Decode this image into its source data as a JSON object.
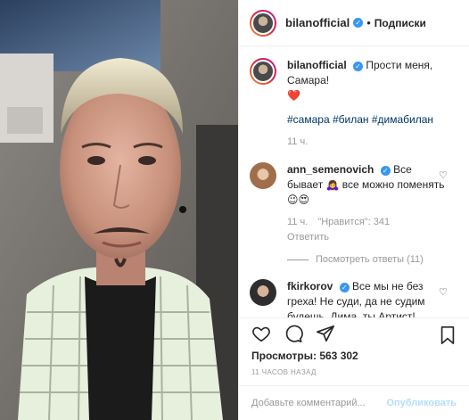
{
  "post": {
    "username": "bilanofficial",
    "follow_label": "Подписки",
    "dot": "•"
  },
  "caption": {
    "username": "bilanofficial",
    "text": "Прости меня, Самара!",
    "emoji": "❤️",
    "tags": "#самара #билан #димабилан",
    "time": "11 ч."
  },
  "comments": [
    {
      "username": "ann_semenovich",
      "text": "Все бывает 🙇‍♀️ все можно поменять 😉😍",
      "time": "11 ч.",
      "likes": "\"Нравится\": 341",
      "reply_label": "Ответить",
      "view_replies": "Посмотреть ответы (11)"
    },
    {
      "username": "fkirkorov",
      "text": "Все мы не без греха! Не суди, да не судим будешь. Дима, ты Артист! Артист с большой буквы. И ещё больше стал им, после этих честных слов. Все забудется, время все"
    }
  ],
  "stats": {
    "views": "Просмотры: 563 302",
    "posted": "11 ЧАСОВ НАЗАД"
  },
  "add_comment": {
    "placeholder": "Добавьте комментарий...",
    "publish": "Опубликовать"
  },
  "icons": [
    "heart-icon",
    "comment-icon",
    "share-icon",
    "bookmark-icon",
    "verified-icon"
  ],
  "colors": {
    "link": "#003569",
    "verified": "#3897f0",
    "muted": "#999999",
    "publish": "#b2dffc"
  }
}
